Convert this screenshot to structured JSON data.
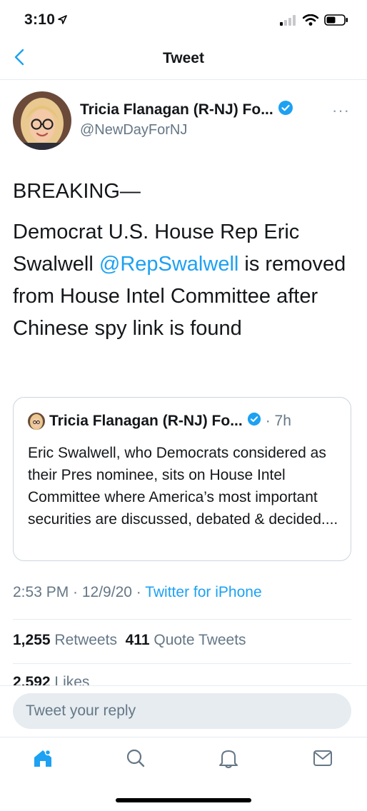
{
  "status_bar": {
    "time": "3:10",
    "icons": [
      "location-arrow-icon",
      "cellular-signal-icon",
      "wifi-icon",
      "battery-icon"
    ]
  },
  "nav": {
    "title": "Tweet",
    "back_icon": "chevron-left-icon"
  },
  "tweet": {
    "author_name": "Tricia Flanagan (R-NJ) Fo...",
    "author_handle": "@NewDayForNJ",
    "verified_icon": "verified-badge-icon",
    "more_label": "···",
    "text_line1": "BREAKING—",
    "text_part1": "Democrat U.S. House Rep Eric Swalwell ",
    "text_mention": "@RepSwalwell",
    "text_part2": " is removed from House Intel Committee after Chinese spy link is found",
    "quote": {
      "author_name": "Tricia Flanagan (R-NJ) Fo...",
      "time": "· 7h",
      "text": "Eric Swalwell, who Democrats considered as their Pres nominee, sits on House Intel Committee where America’s most important securities are discussed, debated & decided...."
    },
    "timestamp": "2:53 PM · 12/9/20 · ",
    "source": "Twitter for iPhone",
    "retweets_count": "1,255",
    "retweets_label": "Retweets",
    "quote_tweets_count": "411",
    "quote_tweets_label": "Quote Tweets",
    "likes_count": "2,592",
    "likes_label": "Likes"
  },
  "reply": {
    "placeholder": "Tweet your reply"
  },
  "tab_bar": {
    "items": [
      "home-icon",
      "search-icon",
      "notifications-bell-icon",
      "messages-mail-icon"
    ]
  },
  "colors": {
    "accent": "#1da1f2",
    "secondary_text": "#657786",
    "divider": "#e6ecf0"
  }
}
